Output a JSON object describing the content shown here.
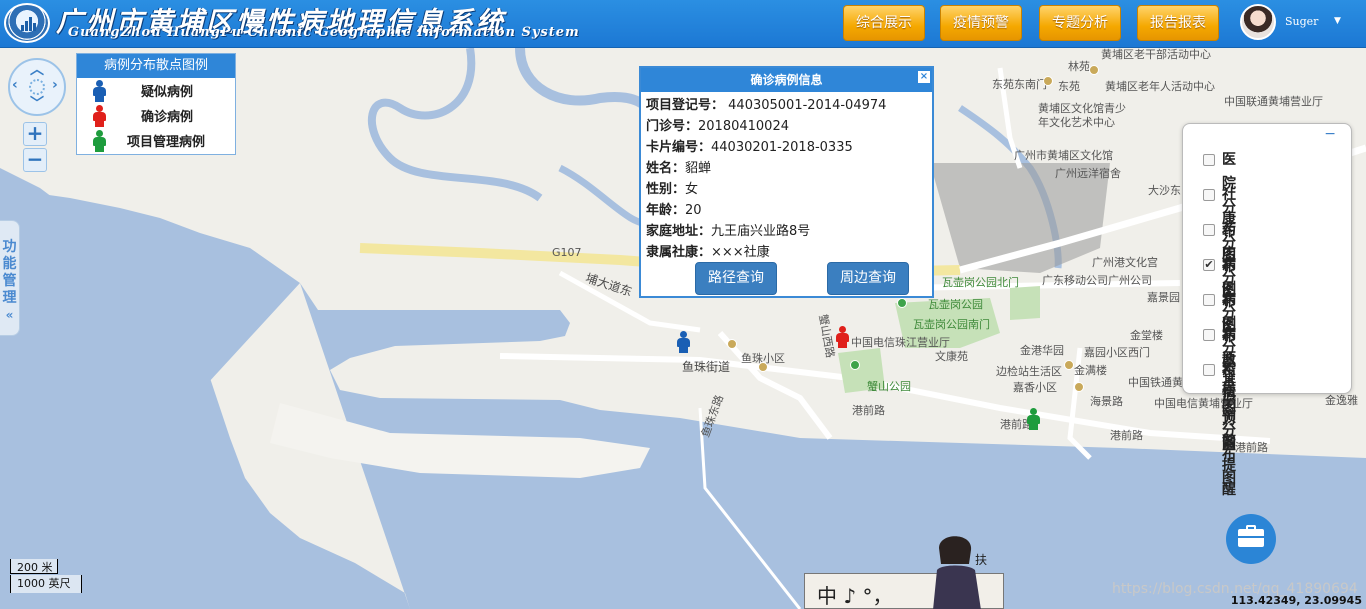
{
  "header": {
    "title_cn": "广州市黄埔区慢性病地理信息系统",
    "title_en": "GuangZhou HuangPu Chronic Geographic Information System",
    "nav": [
      "综合展示",
      "疫情预警",
      "专题分析",
      "报告报表"
    ],
    "username": "Suger"
  },
  "legend": {
    "title": "病例分布散点图例",
    "items": [
      {
        "label": "疑似病例",
        "color": "#1a5fb4"
      },
      {
        "label": "确诊病例",
        "color": "#e0201b"
      },
      {
        "label": "项目管理病例",
        "color": "#1e9c3d"
      }
    ]
  },
  "side_tab": {
    "label": "功能管理",
    "arrow": "«"
  },
  "popup": {
    "title": "确诊病例信息",
    "fields": [
      {
        "key": "项目登记号：",
        "value": " 440305001-2014-04974"
      },
      {
        "key": "门诊号：",
        "value": "20180410024"
      },
      {
        "key": "卡片编号：",
        "value": "44030201-2018-0335"
      },
      {
        "key": "姓名：",
        "value": "貂蝉"
      },
      {
        "key": "性别：",
        "value": "女"
      },
      {
        "key": "年龄：",
        "value": "20"
      },
      {
        "key": "家庭地址：",
        "value": "九王庙兴业路8号"
      },
      {
        "key": "隶属社康：",
        "value": "×××社康"
      }
    ],
    "btn_route": "路径查询",
    "btn_nearby": "周边查询"
  },
  "layers": {
    "items": [
      {
        "label": "医院分布图",
        "checked": false
      },
      {
        "label": "社康分布图",
        "checked": false
      },
      {
        "label": "药店分布图",
        "checked": false
      },
      {
        "label": "病例分布散点图",
        "checked": true
      },
      {
        "label": "病例分布热力图",
        "checked": false
      },
      {
        "label": "病原基因分布图",
        "checked": false
      },
      {
        "label": "疫情预警提醒",
        "checked": false
      }
    ]
  },
  "map_labels": {
    "g107": "G107",
    "pudadao": "埔大道东",
    "yuzhu_jiedao": "鱼珠街道",
    "yuzhu_xiaoqu": "鱼珠小区",
    "yuzhu_donglu": "鱼珠东路",
    "gangqian1": "港前路",
    "gangqian2": "港前路",
    "gangqian3": "港前路",
    "gangqian4": "港前路",
    "gangqian5": "港前路",
    "xieshan": "蟹山公园",
    "dianxin": "中国电信珠江营业厅",
    "wenkang": "文康苑",
    "wahugang_bei": "瓦壶岗公园北门",
    "wahugang": "瓦壶岗公园",
    "wahugang_nan": "瓦壶岗公园南门",
    "yidong": "广东移动公司广州公司",
    "jiaxiang": "嘉景园",
    "jintang": "金堂楼",
    "jingang": "金港华园",
    "jinyuan": "嘉园小区西门",
    "biantu": "边检站生活区",
    "jinman": "金满楼",
    "jinxiang": "嘉香小区",
    "haijing": "海景路",
    "tietong": "中国铁通黄埔",
    "dianxin2": "中国电信黄埔营业厅",
    "jinyi": "金逸雅",
    "wenhua": "黄埔区文化馆青少年文化艺术中心",
    "wenhuaguan": "广州市黄埔区文化馆",
    "yuanyang": "广州远洋宿舍",
    "dongyuan": "东苑东南门",
    "dongyuan2": "东苑",
    "laoren": "黄埔区老年人活动中心",
    "liantong": "中国联通黄埔营业厅",
    "dasha": "大沙东",
    "ganggang": "广州港文化宫",
    "laoganbu": "黄埔区老干部活动中心",
    "linyuan": "林苑",
    "shanxi": "蟹山西路"
  },
  "scale": {
    "top": "200 米",
    "bottom": "1000 英尺"
  },
  "coords": "113.42349, 23.09945",
  "watermark": "https://blog.csdn.net/qq_41890694",
  "ad_text": "中 ♪  °，"
}
